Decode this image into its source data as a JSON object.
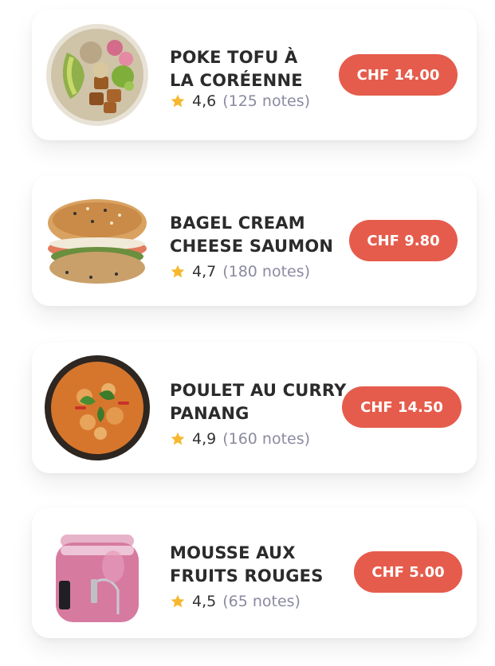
{
  "menu": {
    "items": [
      {
        "name": "POKE TOFU À\nLA CORÉENNE",
        "rating": "4,6",
        "reviews": "(125 notes)",
        "price": "CHF 14.00",
        "icon": "poke-bowl-image"
      },
      {
        "name": "BAGEL CREAM\nCHEESE SAUMON",
        "rating": "4,7",
        "reviews": "(180 notes)",
        "price": "CHF 9.80",
        "icon": "salmon-bagel-image"
      },
      {
        "name": "POULET AU CURRY\nPANANG",
        "rating": "4,9",
        "reviews": "(160 notes)",
        "price": "CHF 14.50",
        "icon": "curry-bowl-image"
      },
      {
        "name": "MOUSSE AUX\nFRUITS ROUGES",
        "rating": "4,5",
        "reviews": "(65 notes)",
        "price": "CHF 5.00",
        "icon": "berry-mousse-jar-image"
      }
    ]
  },
  "colors": {
    "price_button": "#e55c4c",
    "star": "#f5b82e",
    "title_text": "#2b2b2b",
    "reviews_text": "#8a8aa0"
  }
}
